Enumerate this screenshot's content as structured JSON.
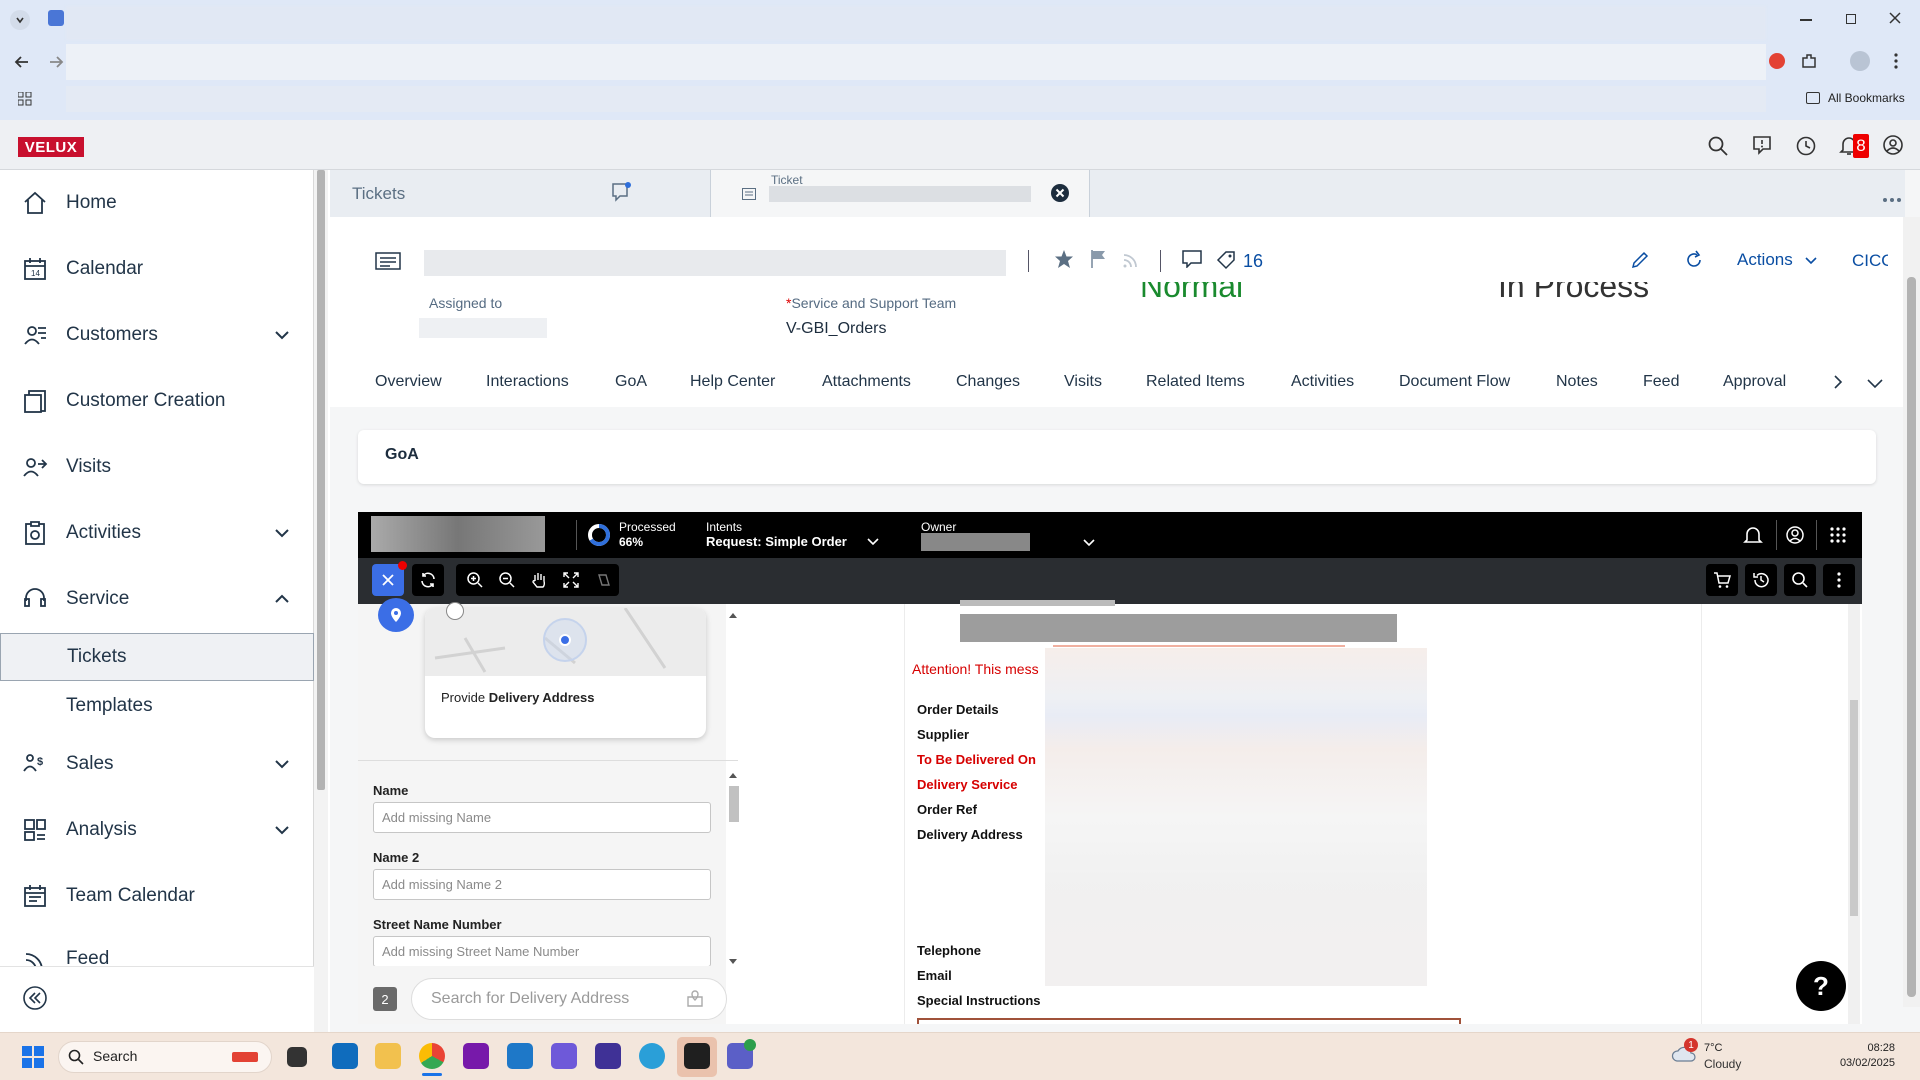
{
  "browser": {
    "bookmarks_label": "All Bookmarks"
  },
  "app": {
    "logo": "VELUX",
    "notification_count": "8",
    "sidebar": {
      "items": [
        {
          "label": "Home"
        },
        {
          "label": "Calendar"
        },
        {
          "label": "Customers"
        },
        {
          "label": "Customer Creation"
        },
        {
          "label": "Visits"
        },
        {
          "label": "Activities"
        },
        {
          "label": "Service"
        },
        {
          "label": "Sales"
        },
        {
          "label": "Analysis"
        },
        {
          "label": "Team Calendar"
        },
        {
          "label": "Feed"
        }
      ],
      "sub_items": [
        {
          "label": "Tickets"
        },
        {
          "label": "Templates"
        }
      ]
    },
    "tabs": {
      "tickets": "Tickets",
      "ticket_small": "Ticket"
    },
    "ticket": {
      "tag_count": "16",
      "actions_label": "Actions",
      "cico_label": "CICO",
      "assigned_to_label": "Assigned to",
      "team_label": "Service and Support Team",
      "required_mark": "*",
      "team_value": "V-GBI_Orders",
      "status_partial_1": "Normal",
      "status_partial_2": "In Process"
    },
    "nav_tabs": [
      "Overview",
      "Interactions",
      "GoA",
      "Help Center",
      "Attachments",
      "Changes",
      "Visits",
      "Related Items",
      "Activities",
      "Document Flow",
      "Notes",
      "Feed",
      "Approval"
    ],
    "goa_title": "GoA"
  },
  "embed": {
    "processed_label": "Processed",
    "processed_value": "66%",
    "processed_fraction": 0.66,
    "intents_label": "Intents",
    "intents_value": "Request: Simple Order",
    "owner_label": "Owner",
    "map_card_text_prefix": "Provide ",
    "map_card_text_bold": "Delivery Address",
    "fields": [
      {
        "label": "Name",
        "placeholder": "Add missing Name"
      },
      {
        "label": "Name 2",
        "placeholder": "Add missing Name 2"
      },
      {
        "label": "Street Name Number",
        "placeholder": "Add missing Street Name Number"
      }
    ],
    "step_number": "2",
    "search_placeholder": "Search for Delivery Address",
    "attention_text": "Attention! This mess",
    "doc_labels": [
      {
        "text": "Order Details",
        "red": false
      },
      {
        "text": "Supplier",
        "red": false
      },
      {
        "text": "To Be Delivered On",
        "red": true
      },
      {
        "text": "Delivery Service",
        "red": true
      },
      {
        "text": "Order Ref",
        "red": false
      },
      {
        "text": "Delivery Address",
        "red": false
      },
      {
        "text": "Telephone",
        "red": false
      },
      {
        "text": "Email",
        "red": false
      },
      {
        "text": "Special Instructions",
        "red": false
      }
    ],
    "help_label": "?"
  },
  "taskbar": {
    "search_label": "Search",
    "weather_temp": "7°C",
    "weather_desc": "Cloudy",
    "weather_badge": "1",
    "time": "08:28",
    "date": "03/02/2025"
  }
}
